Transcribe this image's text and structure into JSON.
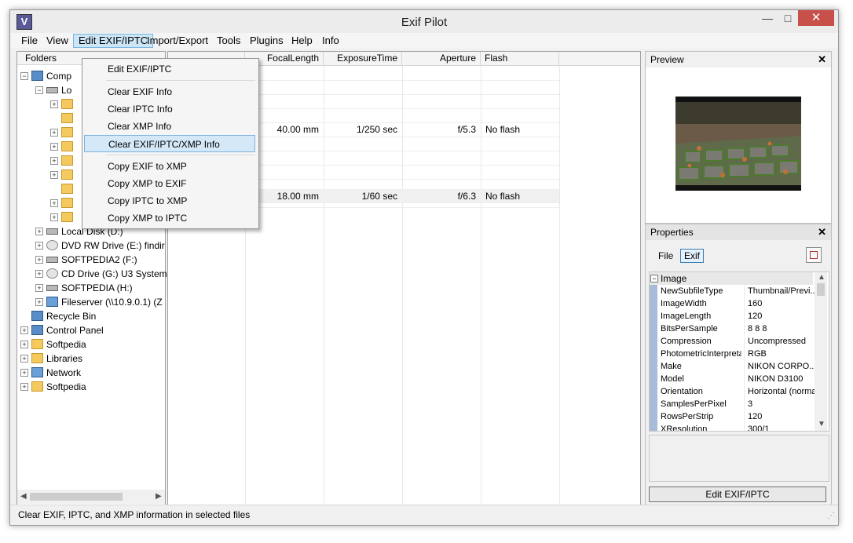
{
  "window": {
    "title": "Exif Pilot",
    "min_glyph": "—",
    "max_glyph": "□",
    "close_glyph": "✕",
    "app_icon_glyph": "V"
  },
  "menu": [
    "File",
    "View",
    "Edit EXIF/IPTC",
    "Import/Export",
    "Tools",
    "Plugins",
    "Help",
    "Info"
  ],
  "folders_header": "Folders",
  "tree": [
    {
      "label": "Comp",
      "indent": 0,
      "icon": "monitor",
      "exp": "−"
    },
    {
      "label": "Lo",
      "indent": 1,
      "icon": "drive",
      "exp": "−"
    },
    {
      "label": "",
      "indent": 2,
      "icon": "folder",
      "exp": "+"
    },
    {
      "label": "",
      "indent": 2,
      "icon": "folder",
      "exp": ""
    },
    {
      "label": "",
      "indent": 2,
      "icon": "folder",
      "exp": "+"
    },
    {
      "label": "",
      "indent": 2,
      "icon": "folder",
      "exp": "+"
    },
    {
      "label": "",
      "indent": 2,
      "icon": "folder",
      "exp": "+"
    },
    {
      "label": "",
      "indent": 2,
      "icon": "folder",
      "exp": "+"
    },
    {
      "label": "",
      "indent": 2,
      "icon": "folder",
      "exp": ""
    },
    {
      "label": "",
      "indent": 2,
      "icon": "folder",
      "exp": "+"
    },
    {
      "label": "",
      "indent": 2,
      "icon": "folder",
      "exp": "+"
    },
    {
      "label": "Local Disk (D:)",
      "indent": 1,
      "icon": "drive",
      "exp": "+"
    },
    {
      "label": "DVD RW Drive (E:) findir",
      "indent": 1,
      "icon": "cd",
      "exp": "+"
    },
    {
      "label": "SOFTPEDIA2 (F:)",
      "indent": 1,
      "icon": "drive",
      "exp": "+"
    },
    {
      "label": "CD Drive (G:) U3 System",
      "indent": 1,
      "icon": "cd",
      "exp": "+"
    },
    {
      "label": "SOFTPEDIA (H:)",
      "indent": 1,
      "icon": "drive",
      "exp": "+"
    },
    {
      "label": "Fileserver (\\\\10.9.0.1) (Z",
      "indent": 1,
      "icon": "net",
      "exp": "+"
    },
    {
      "label": "Recycle Bin",
      "indent": 0,
      "icon": "monitor",
      "exp": ""
    },
    {
      "label": "Control Panel",
      "indent": 0,
      "icon": "monitor",
      "exp": "+"
    },
    {
      "label": "Softpedia",
      "indent": 0,
      "icon": "folder",
      "exp": "+"
    },
    {
      "label": "Libraries",
      "indent": 0,
      "icon": "folder",
      "exp": "+"
    },
    {
      "label": "Network",
      "indent": 0,
      "icon": "net",
      "exp": "+"
    },
    {
      "label": "Softpedia",
      "indent": 0,
      "icon": "folder",
      "exp": "+"
    }
  ],
  "columns": [
    "FocalLength",
    "ExposureTime",
    "Aperture",
    "Flash"
  ],
  "rows": [
    {
      "focal": "40.00 mm",
      "exposure": "1/250 sec",
      "aperture": "f/5.3",
      "flash": "No flash"
    },
    {
      "focal": "18.00 mm",
      "exposure": "1/60 sec",
      "aperture": "f/6.3",
      "flash": "No flash"
    }
  ],
  "dropdown": {
    "edit": "Edit EXIF/IPTC",
    "clear_exif": "Clear EXIF Info",
    "clear_iptc": "Clear IPTC Info",
    "clear_xmp": "Clear XMP Info",
    "clear_all": "Clear EXIF/IPTC/XMP Info",
    "copy_exif_xmp": "Copy EXIF to XMP",
    "copy_xmp_exif": "Copy XMP to EXIF",
    "copy_iptc_xmp": "Copy IPTC to XMP",
    "copy_xmp_iptc": "Copy XMP to IPTC"
  },
  "preview": {
    "title": "Preview"
  },
  "properties": {
    "title": "Properties",
    "file_label": "File",
    "selected": "Exif",
    "section": "Image",
    "items": [
      {
        "k": "NewSubfileType",
        "v": "Thumbnail/Previ..."
      },
      {
        "k": "ImageWidth",
        "v": "160"
      },
      {
        "k": "ImageLength",
        "v": "120"
      },
      {
        "k": "BitsPerSample",
        "v": "8 8 8"
      },
      {
        "k": "Compression",
        "v": "Uncompressed"
      },
      {
        "k": "PhotometricInterpreta",
        "v": "RGB"
      },
      {
        "k": "Make",
        "v": "NIKON CORPO..."
      },
      {
        "k": "Model",
        "v": "NIKON D3100"
      },
      {
        "k": "Orientation",
        "v": "Horizontal (normal)"
      },
      {
        "k": "SamplesPerPixel",
        "v": "3"
      },
      {
        "k": "RowsPerStrip",
        "v": "120"
      },
      {
        "k": "XResolution",
        "v": "300/1"
      }
    ],
    "edit_button": "Edit EXIF/IPTC"
  },
  "status": "Clear EXIF, IPTC, and XMP information in selected files"
}
